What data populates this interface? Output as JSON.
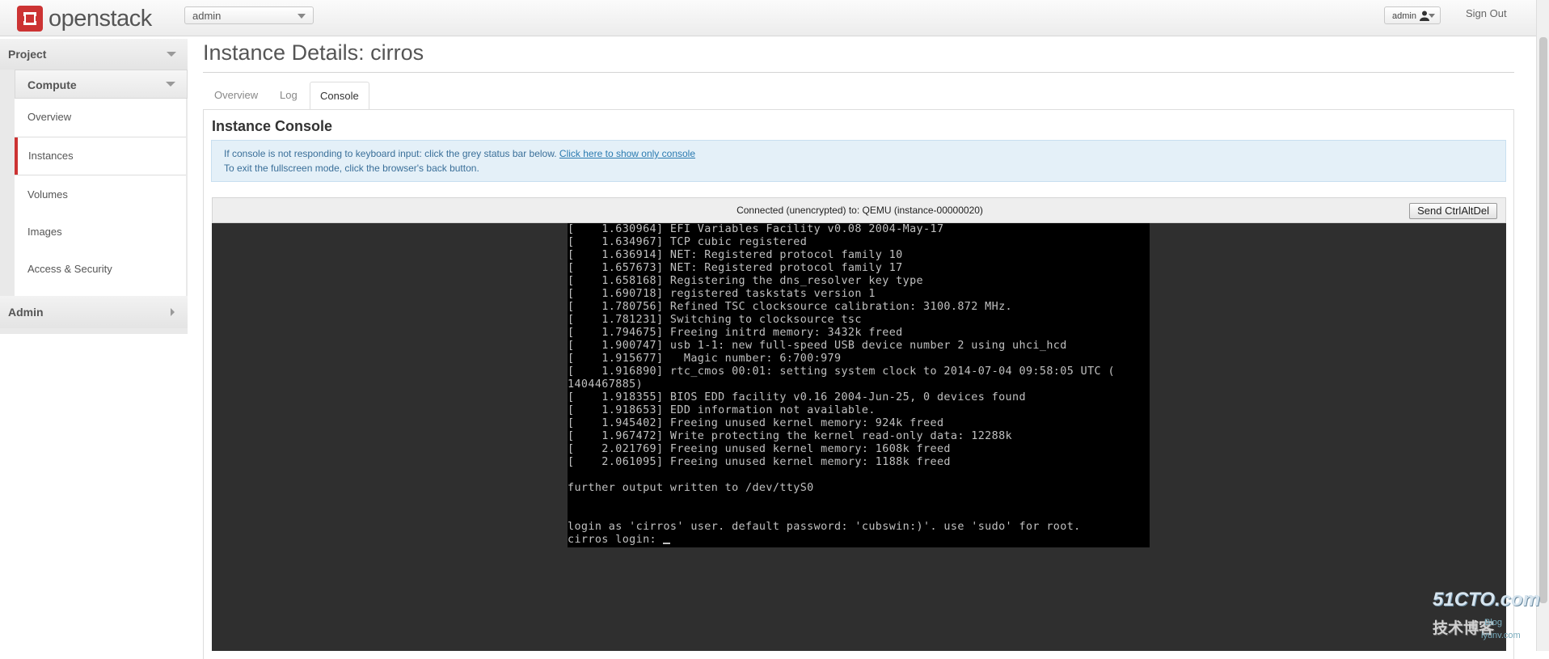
{
  "brand": {
    "name": "openstack"
  },
  "topbar": {
    "project_selector": "admin",
    "user_menu": "admin",
    "sign_out": "Sign Out"
  },
  "sidebar": {
    "dashboard": "Project",
    "panel_group": "Compute",
    "items": [
      {
        "label": "Overview"
      },
      {
        "label": "Instances"
      },
      {
        "label": "Volumes"
      },
      {
        "label": "Images"
      },
      {
        "label": "Access & Security"
      }
    ],
    "admin": "Admin",
    "active_item": "Instances"
  },
  "main": {
    "page_title": "Instance Details: cirros",
    "tabs": [
      {
        "label": "Overview"
      },
      {
        "label": "Log"
      },
      {
        "label": "Console"
      }
    ],
    "active_tab": "Console",
    "panel_title": "Instance Console",
    "info": {
      "line1": "If console is not responding to keyboard input: click the grey status bar below.",
      "link": "Click here to show only console",
      "line2": "To exit the fullscreen mode, click the browser's back button."
    },
    "console_status": "Connected (unencrypted) to: QEMU (instance-00000020)",
    "send_cad": "Send CtrlAltDel"
  },
  "terminal_lines": [
    "[    1.630964] EFI Variables Facility v0.08 2004-May-17",
    "[    1.634967] TCP cubic registered",
    "[    1.636914] NET: Registered protocol family 10",
    "[    1.657673] NET: Registered protocol family 17",
    "[    1.658168] Registering the dns_resolver key type",
    "[    1.690718] registered taskstats version 1",
    "[    1.780756] Refined TSC clocksource calibration: 3100.872 MHz.",
    "[    1.781231] Switching to clocksource tsc",
    "[    1.794675] Freeing initrd memory: 3432k freed",
    "[    1.900747] usb 1-1: new full-speed USB device number 2 using uhci_hcd",
    "[    1.915677]   Magic number: 6:700:979",
    "[    1.916890] rtc_cmos 00:01: setting system clock to 2014-07-04 09:58:05 UTC (",
    "1404467885)",
    "[    1.918355] BIOS EDD facility v0.16 2004-Jun-25, 0 devices found",
    "[    1.918653] EDD information not available.",
    "[    1.945402] Freeing unused kernel memory: 924k freed",
    "[    1.967472] Write protecting the kernel read-only data: 12288k",
    "[    2.021769] Freeing unused kernel memory: 1608k freed",
    "[    2.061095] Freeing unused kernel memory: 1188k freed",
    "",
    "further output written to /dev/ttyS0",
    "",
    "",
    "login as 'cirros' user. default password: 'cubswin:)'. use 'sudo' for root.",
    "cirros login: "
  ],
  "watermark": {
    "line1": "51CTO.com",
    "line2": "技术博客",
    "line3": "Blog",
    "line4": "iyunv.com"
  },
  "colors": {
    "brand_red": "#cc3333",
    "info_bg": "#e4f0f8",
    "console_bg": "#2f2f2f",
    "terminal_bg": "#000000"
  }
}
